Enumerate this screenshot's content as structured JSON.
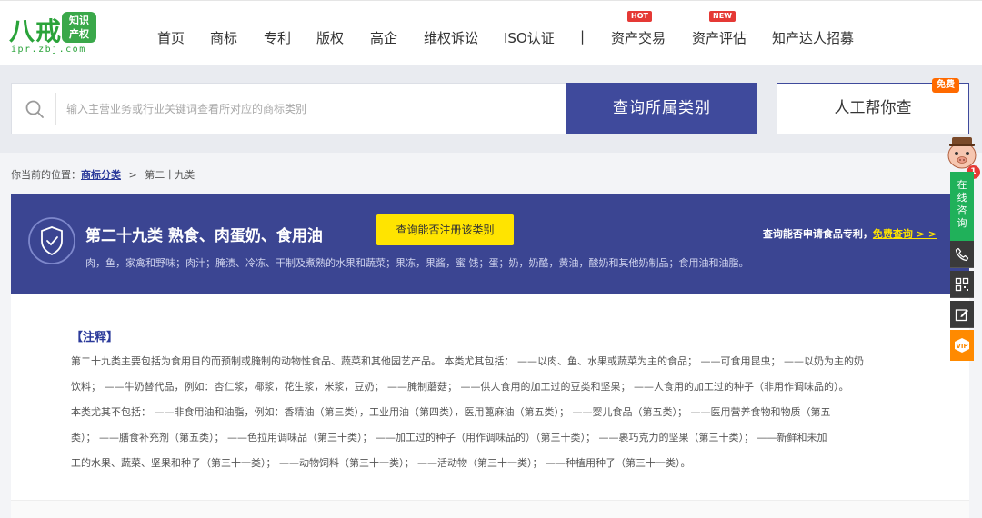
{
  "logo": {
    "brand": "八戒",
    "badge_line1": "知识",
    "badge_line2": "产权",
    "domain": "ipr.zbj.com"
  },
  "nav": {
    "items": [
      {
        "label": "首页"
      },
      {
        "label": "商标"
      },
      {
        "label": "专利"
      },
      {
        "label": "版权"
      },
      {
        "label": "高企"
      },
      {
        "label": "维权诉讼"
      },
      {
        "label": "ISO认证"
      },
      {
        "label": "|"
      },
      {
        "label": "资产交易",
        "tag": "HOT"
      },
      {
        "label": "资产评估",
        "tag": "NEW"
      },
      {
        "label": "知产达人招募"
      }
    ]
  },
  "search": {
    "placeholder": "输入主营业务或行业关键词查看所对应的商标类别",
    "button_label": "查询所属类别",
    "help_label": "人工帮你查",
    "free_tag": "免费"
  },
  "breadcrumb": {
    "prefix": "你当前的位置：",
    "link": "商标分类",
    "separator": ">",
    "current": "第二十九类"
  },
  "banner": {
    "title": "第二十九类 熟食、肉蛋奶、食用油",
    "check_button": "查询能否注册该类别",
    "description": "肉，鱼，家禽和野味；肉汁；腌渍、冷冻、干制及煮熟的水果和蔬菜；果冻，果酱，蜜 饯；蛋；奶，奶酪，黄油，酸奶和其他奶制品；食用油和油脂。",
    "right_text": "查询能否申请食品专利，",
    "right_link": "免费查询 > >"
  },
  "note": {
    "title": "【注释】",
    "lines": [
      "第二十九类主要包括为食用目的而预制或腌制的动物性食品、蔬菜和其他园艺产品。 本类尤其包括： ——以肉、鱼、水果或蔬菜为主的食品； ——可食用昆虫； ——以奶为主的奶",
      "饮料； ——牛奶替代品，例如：杏仁浆，椰浆，花生浆，米浆，豆奶； ——腌制蘑菇； ——供人食用的加工过的豆类和坚果； ——人食用的加工过的种子（非用作调味品的）。",
      "本类尤其不包括： ——非食用油和油脂，例如：香精油（第三类），工业用油（第四类），医用蓖麻油（第五类）； ——婴儿食品（第五类）； ——医用营养食物和物质（第五",
      "类）； ——膳食补充剂（第五类）； ——色拉用调味品（第三十类）； ——加工过的种子（用作调味品的）（第三十类）； ——裹巧克力的坚果（第三十类）； ——新鲜和未加",
      "工的水果、蔬菜、坚果和种子（第三十一类）； ——动物饲料（第三十一类）； ——活动物（第三十一类）； ——种植用种子（第三十一类）。"
    ]
  },
  "side": {
    "badge_count": "1",
    "consult_chars": [
      "在",
      "线",
      "咨",
      "询"
    ],
    "icons": [
      "phone-icon",
      "qrcode-icon",
      "edit-icon",
      "vip-icon"
    ]
  },
  "colors": {
    "primary": "#3f4a9c",
    "banner": "#3b4592",
    "accent": "#ffe400",
    "green": "#20b15a",
    "orange": "#ff8a00"
  }
}
